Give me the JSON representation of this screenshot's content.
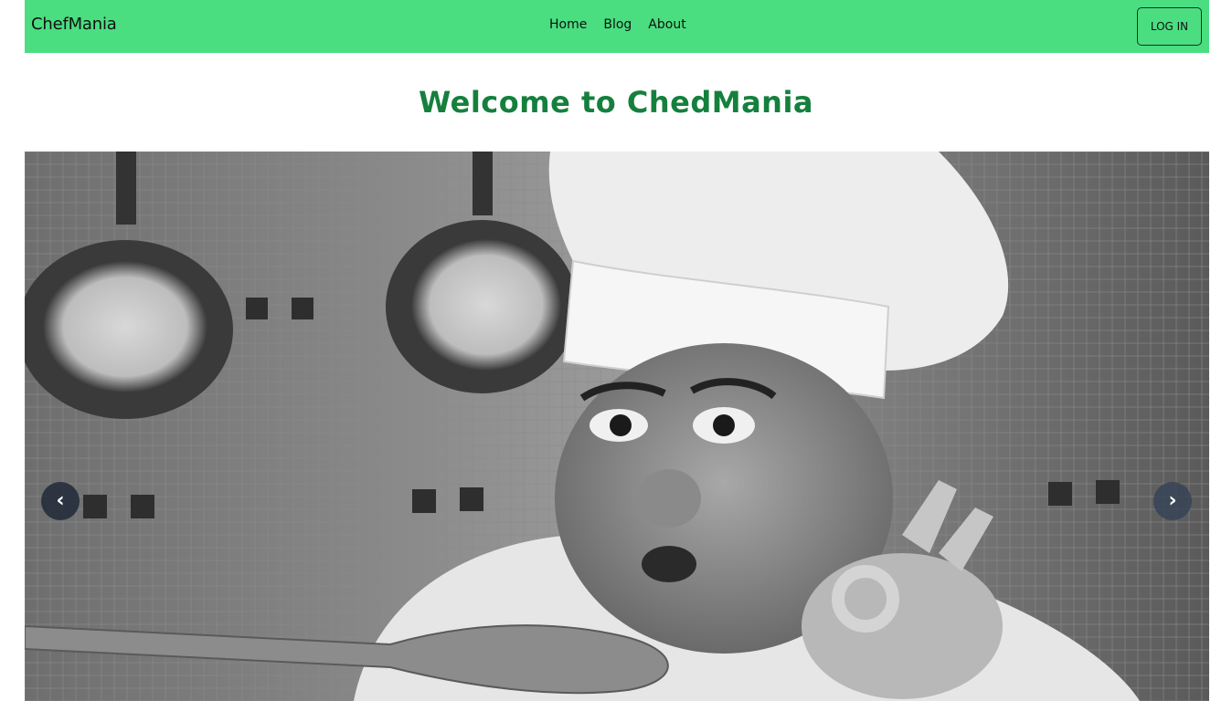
{
  "navbar": {
    "brand": "ChefMania",
    "links": [
      "Home",
      "Blog",
      "About"
    ],
    "login_label": "LOG IN",
    "background_color": "#4ade80"
  },
  "hero": {
    "heading": "Welcome to ChedMania",
    "heading_color": "#15803d"
  },
  "carousel": {
    "slide_image": "chef-tasting-photo",
    "prev_glyph": "‹",
    "next_glyph": "›"
  }
}
